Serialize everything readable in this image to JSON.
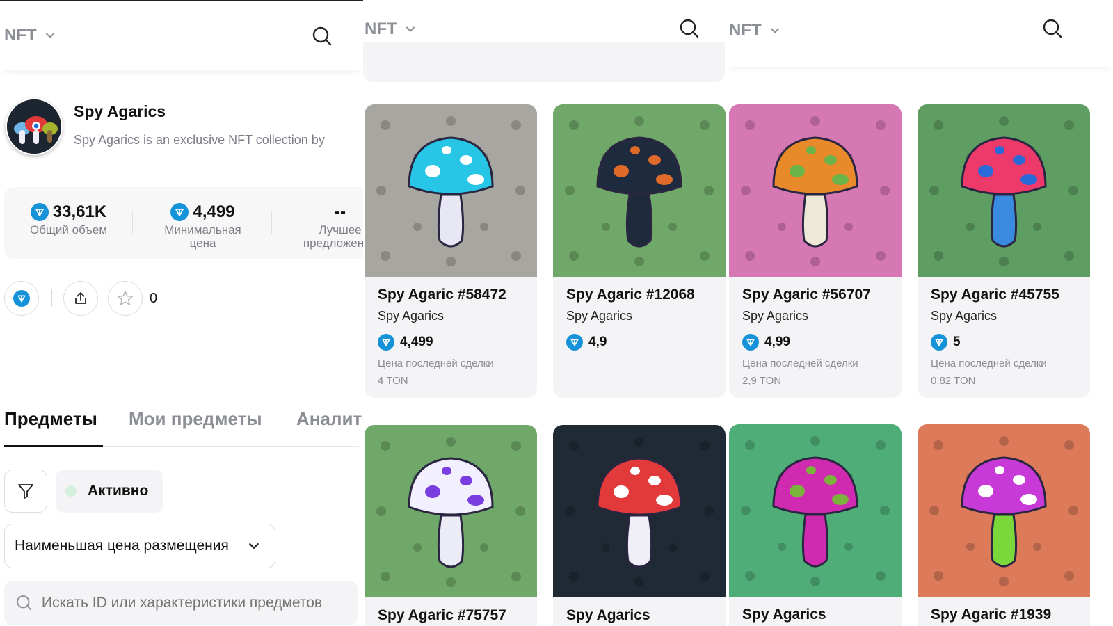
{
  "header": {
    "nft_label": "NFT"
  },
  "collection": {
    "name": "Spy Agarics",
    "description": "Spy Agarics is an exclusive NFT collection by",
    "stats": [
      {
        "value": "33,61K",
        "label": "Общий объем",
        "has_ton": true
      },
      {
        "value": "4,499",
        "label": "Минимальная цена",
        "has_ton": true
      },
      {
        "value": "--",
        "label": "Лучшее предложение",
        "has_ton": false
      }
    ],
    "favorites_count": "0"
  },
  "tabs": [
    "Предметы",
    "Мои предметы",
    "Аналитика"
  ],
  "filters": {
    "status_chip": "Активно",
    "sort_label": "Наименьшая цена размещения",
    "search_placeholder": "Искать ID или характеристики предметов"
  },
  "last_sale_label": "Цена последней сделки",
  "cards": [
    {
      "name": "Spy Agaric #58472",
      "collection": "Spy Agarics",
      "price": "4,499",
      "last_price": "4 TON",
      "bg": "#a8a6a0",
      "cap": "#27c6e6",
      "stem": "#e8e8f4",
      "spots": "#ffffff"
    },
    {
      "name": "Spy Agaric #12068",
      "collection": "Spy Agarics",
      "price": "4,9",
      "last_price": "",
      "bg": "#6fa868",
      "cap": "#1e2a3e",
      "stem": "#1d2a3c",
      "spots": "#e06a2a"
    },
    {
      "name": "Spy Agaric #56707",
      "collection": "Spy Agarics",
      "price": "4,99",
      "last_price": "2,9 TON",
      "bg": "#d678b4",
      "cap": "#e88a2a",
      "stem": "#eee8d6",
      "spots": "#6ab44a"
    },
    {
      "name": "Spy Agaric #45755",
      "collection": "Spy Agarics",
      "price": "5",
      "last_price": "0,82 TON",
      "bg": "#5e9e62",
      "cap": "#ee3a6a",
      "stem": "#3a8ae0",
      "spots": "#2a6ad8"
    },
    {
      "name": "Spy Agaric #75757",
      "collection": "Spy Agarics",
      "price": "",
      "last_price": "",
      "bg": "#6fa868",
      "cap": "#f2f0ff",
      "stem": "#ececf6",
      "spots": "#7a3ee0"
    },
    {
      "name": "Spy Agarics",
      "collection": "",
      "price": "",
      "last_price": "",
      "bg": "#1f2a34",
      "cap": "#e23a3a",
      "stem": "#f0eef6",
      "spots": "#ffffff"
    },
    {
      "name": "Spy Agarics",
      "collection": "",
      "price": "",
      "last_price": "",
      "bg": "#4fae78",
      "cap": "#d02ab0",
      "stem": "#d02ab0",
      "spots": "#7ab43a"
    },
    {
      "name": "Spy Agaric #1939",
      "collection": "",
      "price": "",
      "last_price": "",
      "bg": "#dc7a5a",
      "cap": "#c83ad8",
      "stem": "#7ad83a",
      "spots": "#ffffff"
    }
  ],
  "icon_names": {
    "search": "search-icon",
    "chevron": "chevron-down-icon",
    "ton": "ton-coin-icon",
    "share": "share-icon",
    "star": "star-icon",
    "filter": "filter-icon"
  }
}
